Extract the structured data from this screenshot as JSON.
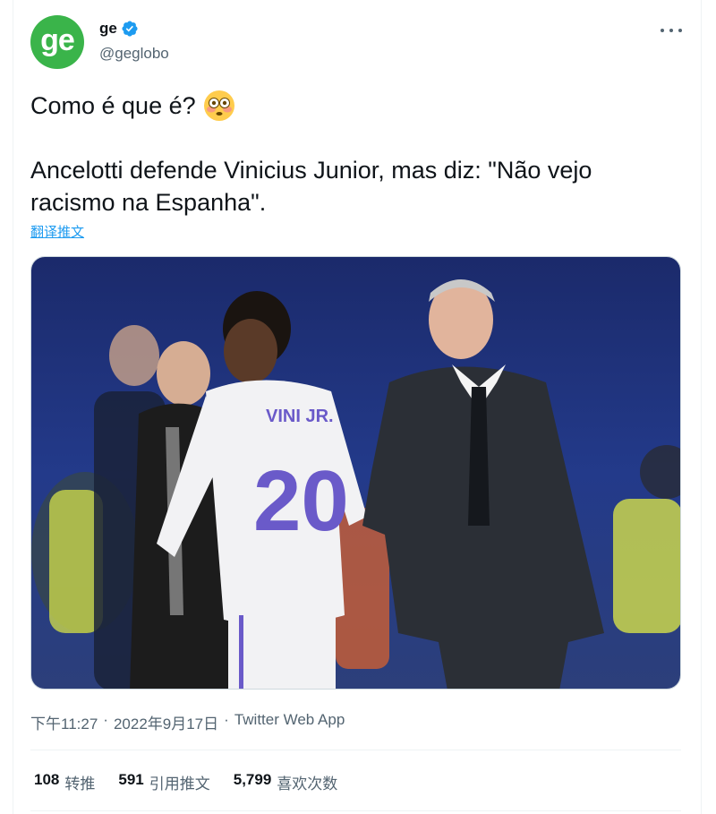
{
  "author": {
    "display_name": "ge",
    "handle": "@geglobo",
    "avatar_text": "ge",
    "avatar_color": "#3ab44a",
    "verified": true
  },
  "tweet": {
    "line1": "Como é que é?",
    "line1_emoji": "flushed-face-emoji",
    "line2": "Ancelotti defende Vinicius Junior, mas diz: \"Não vejo racismo na Espanha\".",
    "translate_link": "翻译推文"
  },
  "media": {
    "jersey_name": "VINI JR.",
    "jersey_number": "20"
  },
  "meta": {
    "time": "下午11:27",
    "date": "2022年9月17日",
    "source": "Twitter Web App",
    "separator": "·"
  },
  "stats": {
    "retweets": {
      "count": "108",
      "label": "转推"
    },
    "quotes": {
      "count": "591",
      "label": "引用推文"
    },
    "likes": {
      "count": "5,799",
      "label": "喜欢次数"
    }
  },
  "colors": {
    "text": "#0f1419",
    "secondary": "#536471",
    "link": "#1d9bf0",
    "verified_badge": "#1d9bf0"
  },
  "icons": {
    "verified": "verified-badge-icon",
    "more": "more-horizontal-icon"
  }
}
